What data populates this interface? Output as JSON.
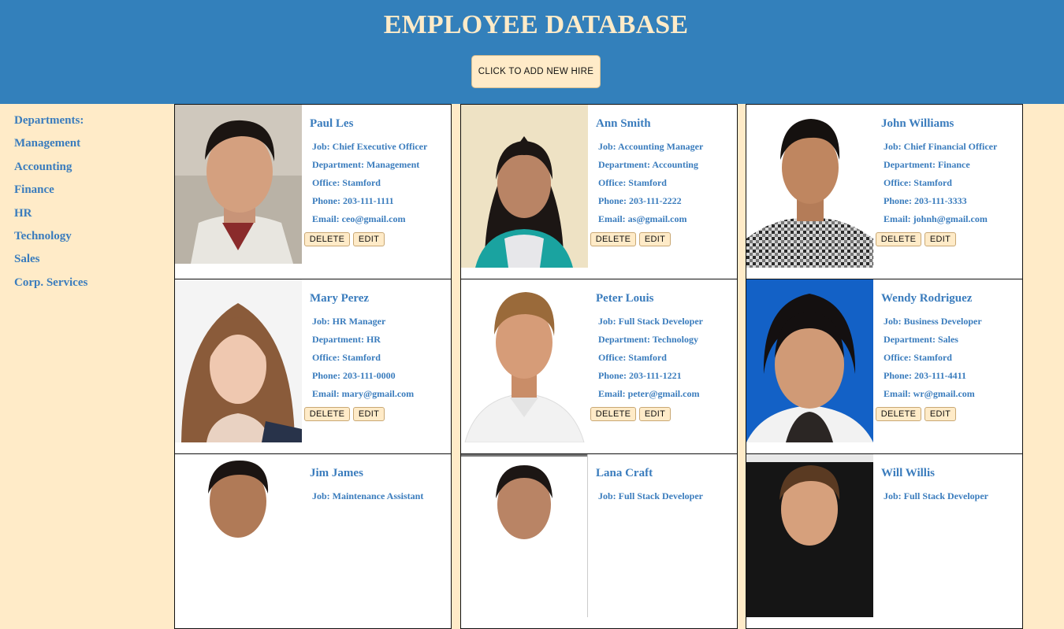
{
  "header": {
    "title": "EMPLOYEE DATABASE",
    "add_button_label": "CLICK TO ADD NEW HIRE"
  },
  "sidebar": {
    "heading": "Departments:",
    "items": [
      "Management",
      "Accounting",
      "Finance",
      "HR",
      "Technology",
      "Sales",
      "Corp. Services"
    ]
  },
  "card_buttons": {
    "delete_label": "DELETE",
    "edit_label": "EDIT"
  },
  "employees": [
    {
      "name": "Paul Les",
      "job": "Job: Chief Executive Officer",
      "department": "Department: Management",
      "office": "Office: Stamford",
      "phone": "Phone: 203-111-1111",
      "email": "Email: ceo@gmail.com"
    },
    {
      "name": "Ann Smith",
      "job": "Job: Accounting Manager",
      "department": "Department: Accounting",
      "office": "Office: Stamford",
      "phone": "Phone: 203-111-2222",
      "email": "Email: as@gmail.com"
    },
    {
      "name": "John Williams",
      "job": "Job: Chief Financial Officer",
      "department": "Department: Finance",
      "office": "Office: Stamford",
      "phone": "Phone: 203-111-3333",
      "email": "Email: johnh@gmail.com"
    },
    {
      "name": "Mary Perez",
      "job": "Job: HR Manager",
      "department": "Department: HR",
      "office": "Office: Stamford",
      "phone": "Phone: 203-111-0000",
      "email": "Email: mary@gmail.com"
    },
    {
      "name": "Peter Louis",
      "job": "Job: Full Stack Developer",
      "department": "Department: Technology",
      "office": "Office: Stamford",
      "phone": "Phone: 203-111-1221",
      "email": "Email: peter@gmail.com"
    },
    {
      "name": "Wendy Rodriguez",
      "job": "Job: Business Developer",
      "department": "Department: Sales",
      "office": "Office: Stamford",
      "phone": "Phone: 203-111-4411",
      "email": "Email: wr@gmail.com"
    },
    {
      "name": "Jim James",
      "job": "Job: Maintenance Assistant"
    },
    {
      "name": "Lana Craft",
      "job": "Job: Full Stack Developer"
    },
    {
      "name": "Will Willis",
      "job": "Job: Full Stack Developer"
    }
  ],
  "colors": {
    "header_bg": "#3380bb",
    "page_bg": "#ffebc8",
    "accent_text": "#3a7cbd",
    "button_bg": "#ffebc8"
  }
}
